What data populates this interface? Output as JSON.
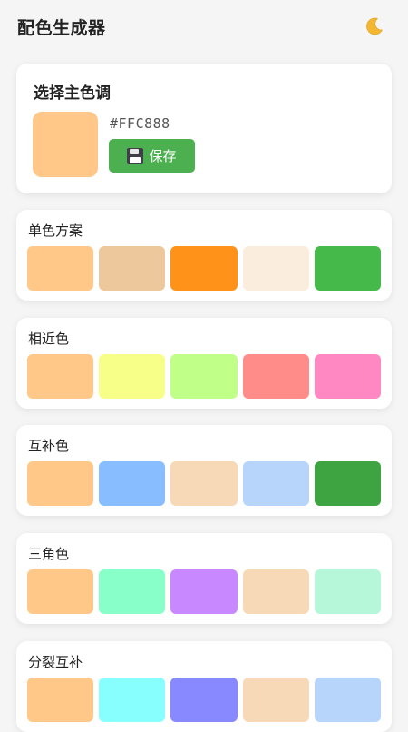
{
  "header": {
    "title": "配色生成器",
    "theme_icon": "moon-icon"
  },
  "picker": {
    "title": "选择主色调",
    "hex": "#FFC888",
    "color": "#FFC888",
    "save_label": "保存",
    "save_icon": "floppy-disk-icon",
    "save_color": "#4caf50"
  },
  "schemes": [
    {
      "name": "单色方案",
      "colors": [
        "#FFC888",
        "#EDC89C",
        "#FF9319",
        "#FAEDDE",
        "#45BA4A"
      ]
    },
    {
      "name": "相近色",
      "colors": [
        "#FFC888",
        "#F8FF88",
        "#C0FF88",
        "#FF8C88",
        "#FF88C2"
      ]
    },
    {
      "name": "互补色",
      "colors": [
        "#FFC888",
        "#88BEFF",
        "#F7D9B7",
        "#B7D5FA",
        "#3DA441"
      ]
    },
    {
      "name": "三角色",
      "colors": [
        "#FFC888",
        "#88FFC8",
        "#C888FF",
        "#F7D9B7",
        "#B7F7D9"
      ]
    },
    {
      "name": "分裂互补",
      "colors": [
        "#FFC888",
        "#88FFFF",
        "#8888FF",
        "#F7D9B7",
        "#B7D5FA"
      ]
    }
  ]
}
